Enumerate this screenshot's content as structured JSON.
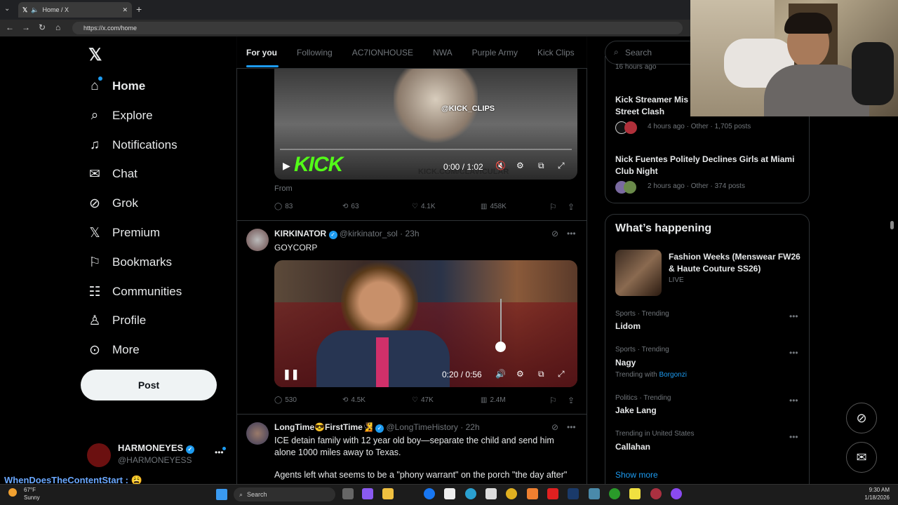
{
  "browser": {
    "tab_title": "Home / X",
    "url": "https://x.com/home"
  },
  "sidebar": {
    "items": [
      {
        "label": "Home",
        "icon": "home-icon"
      },
      {
        "label": "Explore",
        "icon": "search-icon"
      },
      {
        "label": "Notifications",
        "icon": "bell-icon"
      },
      {
        "label": "Chat",
        "icon": "mail-icon"
      },
      {
        "label": "Grok",
        "icon": "grok-icon"
      },
      {
        "label": "Premium",
        "icon": "x-logo-icon"
      },
      {
        "label": "Bookmarks",
        "icon": "bookmark-icon"
      },
      {
        "label": "Communities",
        "icon": "communities-icon"
      },
      {
        "label": "Profile",
        "icon": "person-icon"
      },
      {
        "label": "More",
        "icon": "more-circle-icon"
      }
    ],
    "post_label": "Post",
    "account": {
      "name": "HARMONEYES",
      "handle": "@HARMONEYESS"
    }
  },
  "feed": {
    "tabs": [
      "For you",
      "Following",
      "AC7IONHOUSE",
      "NWA",
      "Purple Army",
      "Kick Clips"
    ],
    "post1": {
      "video_time": "0:00 / 1:02",
      "from": "From",
      "replies": "83",
      "reposts": "63",
      "likes": "4.1K",
      "views": "458K",
      "watermark": "KICK.COM/CLAVICULAR",
      "brand": "KICK",
      "clip_tag": "@KICK_CLIPS"
    },
    "post2": {
      "name": "KIRKINATOR",
      "handle": "@kirkinator_sol",
      "time": "23h",
      "text": "GOYCORP",
      "video_time": "0:20 / 0:56",
      "replies": "530",
      "reposts": "4.5K",
      "likes": "47K",
      "views": "2.4M"
    },
    "post3": {
      "name": "LongTime😎FirstTime🧏",
      "handle": "@LongTimeHistory",
      "time": "22h",
      "text": "ICE detain family with 12 year old boy—separate the child and send him alone 1000 miles away to Texas.",
      "text2": "Agents left what seems to be a \"phony warrant\" on the porch \"the day after\""
    }
  },
  "right": {
    "search_placeholder": "Search",
    "top_news": [
      {
        "meta_top": "16 hours ago"
      },
      {
        "title": "Kick Streamer Mis Street Clash",
        "meta": "4 hours ago · Other · 1,705 posts"
      },
      {
        "title": "Nick Fuentes Politely Declines Girls at Miami Club Night",
        "meta": "2 hours ago · Other · 374 posts"
      }
    ],
    "whats_happening": "What’s happening",
    "event": {
      "title": "Fashion Weeks (Menswear FW26 & Haute Couture SS26)",
      "status": "LIVE"
    },
    "trends": [
      {
        "meta": "Sports · Trending",
        "title": "Lidom"
      },
      {
        "meta": "Sports · Trending",
        "title": "Nagy",
        "with": "Trending with",
        "with_link": "Borgonzi"
      },
      {
        "meta": "Politics · Trending",
        "title": "Jake Lang"
      },
      {
        "meta": "Trending in United States",
        "title": "Callahan"
      }
    ],
    "show_more": "Show more"
  },
  "stream": {
    "chat_user": "WhenDoesTheContentStart :"
  },
  "taskbar": {
    "weather_temp": "67°F",
    "weather_desc": "Sunny",
    "search": "Search",
    "time": "9:30 AM",
    "date": "1/18/2026"
  }
}
